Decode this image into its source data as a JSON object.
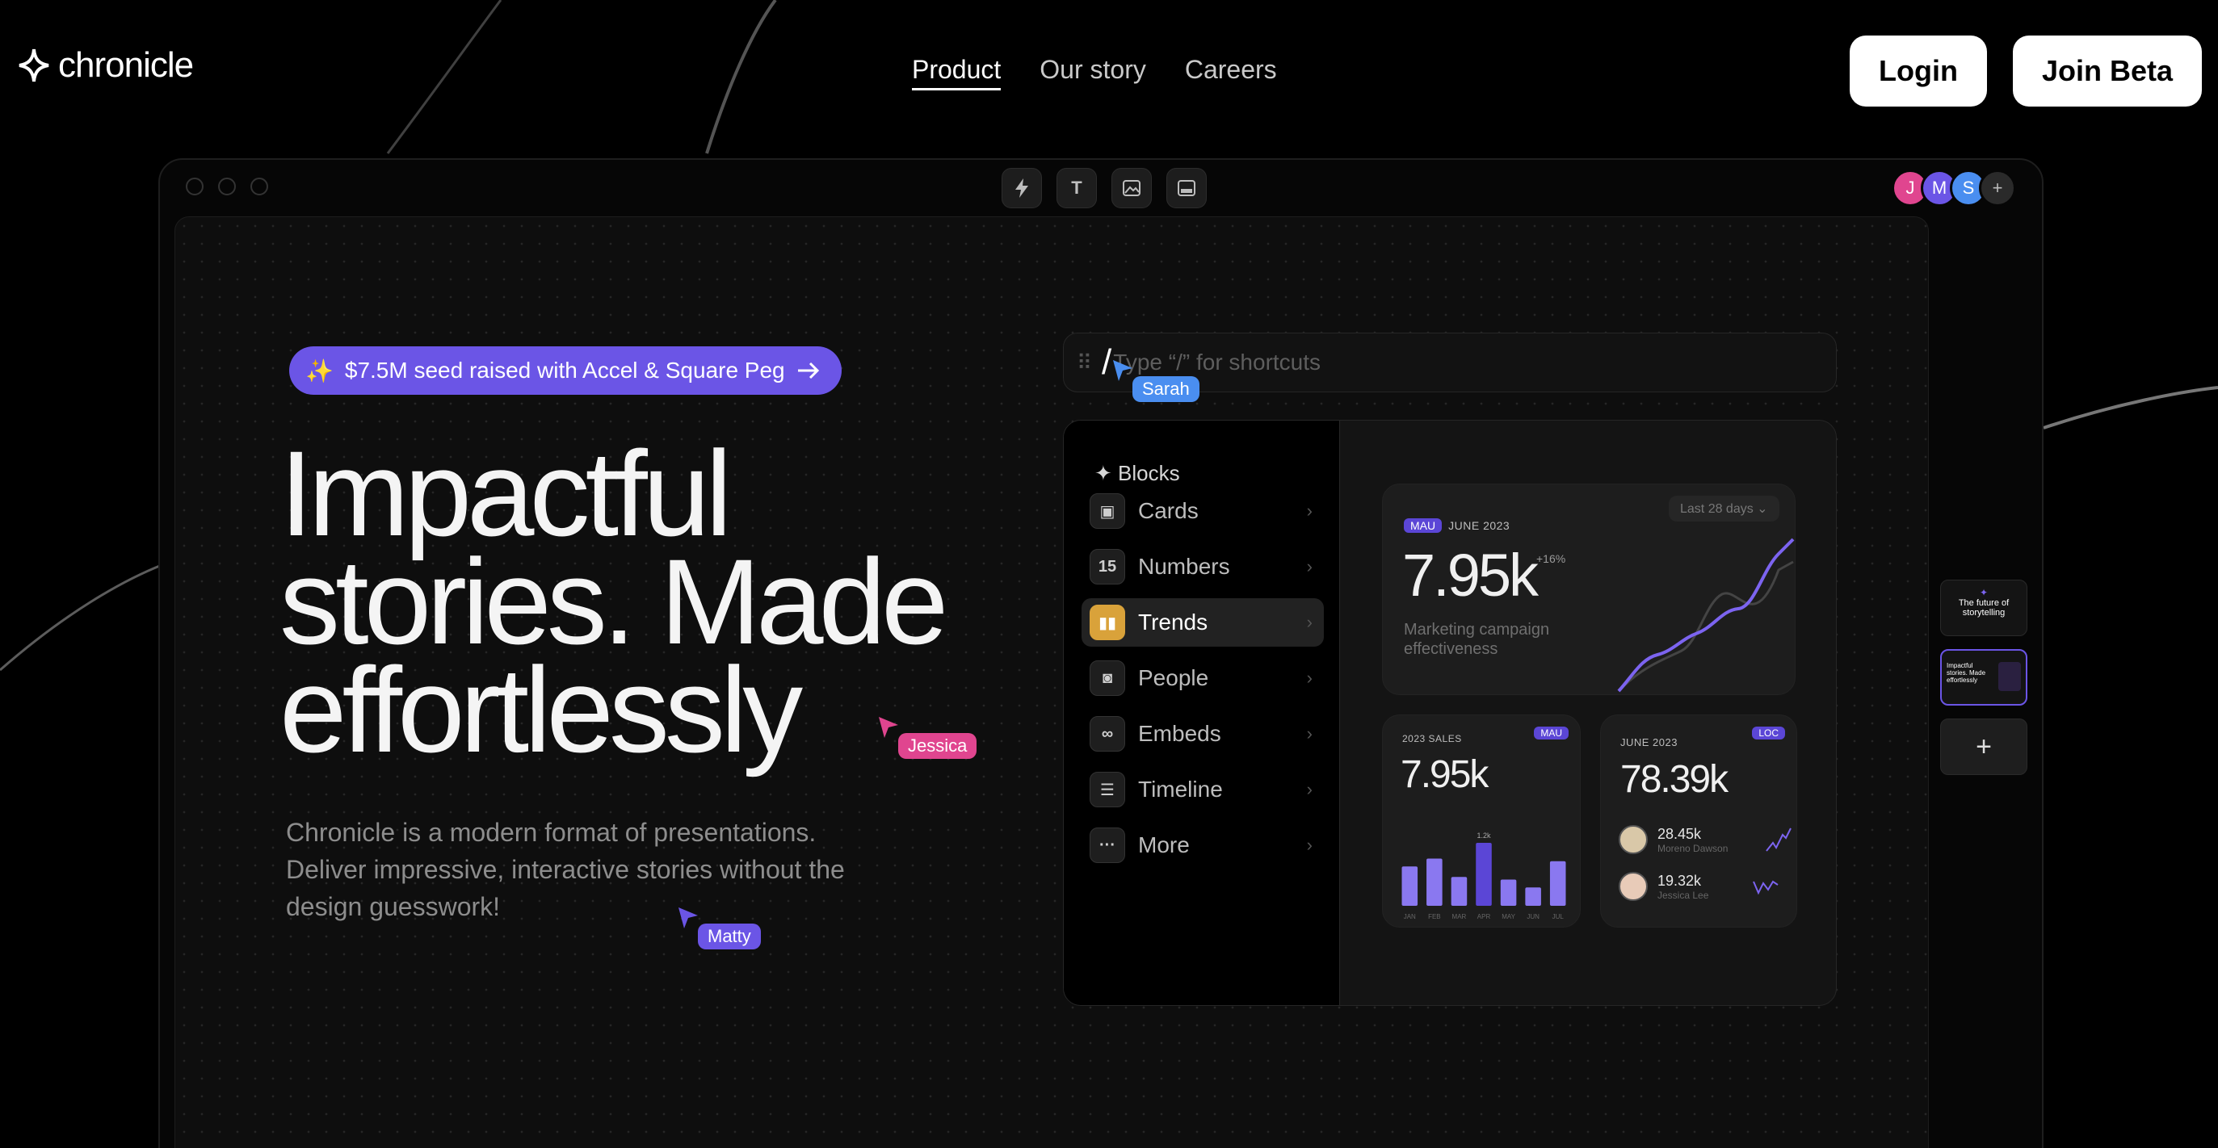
{
  "nav": {
    "logo_text": "chronicle",
    "links": [
      "Product",
      "Our story",
      "Careers"
    ],
    "login_label": "Login",
    "join_label": "Join Beta"
  },
  "toolbar": {
    "tools": [
      "bolt-icon",
      "text-icon",
      "image-icon",
      "layout-icon"
    ],
    "text_tool_glyph": "T",
    "avatars": [
      {
        "initial": "J",
        "color": "#e0458f"
      },
      {
        "initial": "M",
        "color": "#6b55e6"
      },
      {
        "initial": "S",
        "color": "#4a8ef0"
      }
    ],
    "add_label": "+"
  },
  "hero": {
    "badge": "$7.5M seed raised with Accel & Square Peg",
    "badge_emoji": "✨",
    "headline": [
      "Impactful",
      "stories. Made",
      "effortlessly"
    ],
    "description": "Chronicle is a modern format of presentations. Deliver impressive, interactive stories without the design guesswork!"
  },
  "cursors": {
    "jessica": {
      "name": "Jessica",
      "color": "#e0458f"
    },
    "matty": {
      "name": "Matty",
      "color": "#6b55e6"
    },
    "sarah": {
      "name": "Sarah",
      "color": "#4a8ef0"
    }
  },
  "editor": {
    "command_caret": "/",
    "command_placeholder": "Type “/” for shortcuts",
    "blocks_title": "✦ Blocks",
    "blocks": [
      {
        "label": "Cards",
        "icon": "image-icon",
        "glyph": "▣"
      },
      {
        "label": "Numbers",
        "icon": "number-icon",
        "glyph": "15"
      },
      {
        "label": "Trends",
        "icon": "bar-chart-icon",
        "glyph": "▮▮"
      },
      {
        "label": "People",
        "icon": "person-icon",
        "glyph": "◙"
      },
      {
        "label": "Embeds",
        "icon": "link-icon",
        "glyph": "∞"
      },
      {
        "label": "Timeline",
        "icon": "timeline-icon",
        "glyph": "☰"
      },
      {
        "label": "More",
        "icon": "more-icon",
        "glyph": "···"
      }
    ],
    "active_block": "Trends"
  },
  "cards": {
    "main": {
      "tag": "MAU",
      "period": "JUNE 2023",
      "range": "Last 28 days ⌄",
      "value": "7.95k",
      "change": "+16%",
      "caption": "Marketing campaign effectiveness"
    },
    "sales": {
      "title": "2023 SALES",
      "tag": "MAU",
      "value": "7.95k",
      "peak_label": "1.2k"
    },
    "people": {
      "title": "JUNE 2023",
      "tag": "LOC",
      "value": "78.39k",
      "people": [
        {
          "value": "28.45k",
          "name": "Moreno Dawson"
        },
        {
          "value": "19.32k",
          "name": "Jessica Lee"
        }
      ]
    }
  },
  "chart_data": {
    "type": "bar",
    "categories": [
      "JAN",
      "FEB",
      "MAR",
      "APR",
      "MAY",
      "JUN",
      "JUL"
    ],
    "values": [
      0.75,
      0.9,
      0.55,
      1.2,
      0.5,
      0.35,
      0.85
    ],
    "title": "2023 SALES",
    "highlight": "APR",
    "colors": {
      "bar": "#8a78f0",
      "highlight": "#5b46d6"
    }
  },
  "thumbnails": {
    "first": "The future of storytelling",
    "second": "Impactful stories. Made effortlessly",
    "add": "+"
  }
}
